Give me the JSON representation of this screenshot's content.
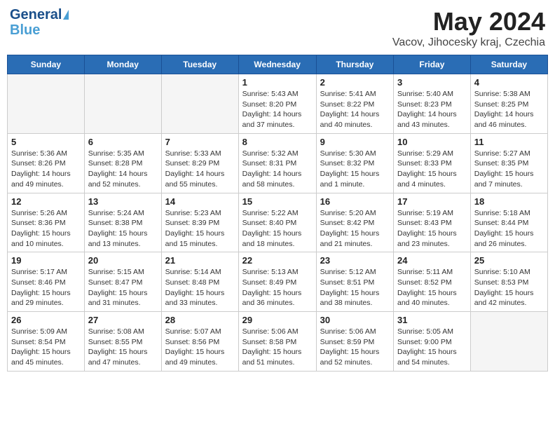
{
  "logo": {
    "line1": "General",
    "line2": "Blue"
  },
  "title": "May 2024",
  "subtitle": "Vacov, Jihocesky kraj, Czechia",
  "days_of_week": [
    "Sunday",
    "Monday",
    "Tuesday",
    "Wednesday",
    "Thursday",
    "Friday",
    "Saturday"
  ],
  "weeks": [
    [
      {
        "day": "",
        "info": ""
      },
      {
        "day": "",
        "info": ""
      },
      {
        "day": "",
        "info": ""
      },
      {
        "day": "1",
        "info": "Sunrise: 5:43 AM\nSunset: 8:20 PM\nDaylight: 14 hours\nand 37 minutes."
      },
      {
        "day": "2",
        "info": "Sunrise: 5:41 AM\nSunset: 8:22 PM\nDaylight: 14 hours\nand 40 minutes."
      },
      {
        "day": "3",
        "info": "Sunrise: 5:40 AM\nSunset: 8:23 PM\nDaylight: 14 hours\nand 43 minutes."
      },
      {
        "day": "4",
        "info": "Sunrise: 5:38 AM\nSunset: 8:25 PM\nDaylight: 14 hours\nand 46 minutes."
      }
    ],
    [
      {
        "day": "5",
        "info": "Sunrise: 5:36 AM\nSunset: 8:26 PM\nDaylight: 14 hours\nand 49 minutes."
      },
      {
        "day": "6",
        "info": "Sunrise: 5:35 AM\nSunset: 8:28 PM\nDaylight: 14 hours\nand 52 minutes."
      },
      {
        "day": "7",
        "info": "Sunrise: 5:33 AM\nSunset: 8:29 PM\nDaylight: 14 hours\nand 55 minutes."
      },
      {
        "day": "8",
        "info": "Sunrise: 5:32 AM\nSunset: 8:31 PM\nDaylight: 14 hours\nand 58 minutes."
      },
      {
        "day": "9",
        "info": "Sunrise: 5:30 AM\nSunset: 8:32 PM\nDaylight: 15 hours\nand 1 minute."
      },
      {
        "day": "10",
        "info": "Sunrise: 5:29 AM\nSunset: 8:33 PM\nDaylight: 15 hours\nand 4 minutes."
      },
      {
        "day": "11",
        "info": "Sunrise: 5:27 AM\nSunset: 8:35 PM\nDaylight: 15 hours\nand 7 minutes."
      }
    ],
    [
      {
        "day": "12",
        "info": "Sunrise: 5:26 AM\nSunset: 8:36 PM\nDaylight: 15 hours\nand 10 minutes."
      },
      {
        "day": "13",
        "info": "Sunrise: 5:24 AM\nSunset: 8:38 PM\nDaylight: 15 hours\nand 13 minutes."
      },
      {
        "day": "14",
        "info": "Sunrise: 5:23 AM\nSunset: 8:39 PM\nDaylight: 15 hours\nand 15 minutes."
      },
      {
        "day": "15",
        "info": "Sunrise: 5:22 AM\nSunset: 8:40 PM\nDaylight: 15 hours\nand 18 minutes."
      },
      {
        "day": "16",
        "info": "Sunrise: 5:20 AM\nSunset: 8:42 PM\nDaylight: 15 hours\nand 21 minutes."
      },
      {
        "day": "17",
        "info": "Sunrise: 5:19 AM\nSunset: 8:43 PM\nDaylight: 15 hours\nand 23 minutes."
      },
      {
        "day": "18",
        "info": "Sunrise: 5:18 AM\nSunset: 8:44 PM\nDaylight: 15 hours\nand 26 minutes."
      }
    ],
    [
      {
        "day": "19",
        "info": "Sunrise: 5:17 AM\nSunset: 8:46 PM\nDaylight: 15 hours\nand 29 minutes."
      },
      {
        "day": "20",
        "info": "Sunrise: 5:15 AM\nSunset: 8:47 PM\nDaylight: 15 hours\nand 31 minutes."
      },
      {
        "day": "21",
        "info": "Sunrise: 5:14 AM\nSunset: 8:48 PM\nDaylight: 15 hours\nand 33 minutes."
      },
      {
        "day": "22",
        "info": "Sunrise: 5:13 AM\nSunset: 8:49 PM\nDaylight: 15 hours\nand 36 minutes."
      },
      {
        "day": "23",
        "info": "Sunrise: 5:12 AM\nSunset: 8:51 PM\nDaylight: 15 hours\nand 38 minutes."
      },
      {
        "day": "24",
        "info": "Sunrise: 5:11 AM\nSunset: 8:52 PM\nDaylight: 15 hours\nand 40 minutes."
      },
      {
        "day": "25",
        "info": "Sunrise: 5:10 AM\nSunset: 8:53 PM\nDaylight: 15 hours\nand 42 minutes."
      }
    ],
    [
      {
        "day": "26",
        "info": "Sunrise: 5:09 AM\nSunset: 8:54 PM\nDaylight: 15 hours\nand 45 minutes."
      },
      {
        "day": "27",
        "info": "Sunrise: 5:08 AM\nSunset: 8:55 PM\nDaylight: 15 hours\nand 47 minutes."
      },
      {
        "day": "28",
        "info": "Sunrise: 5:07 AM\nSunset: 8:56 PM\nDaylight: 15 hours\nand 49 minutes."
      },
      {
        "day": "29",
        "info": "Sunrise: 5:06 AM\nSunset: 8:58 PM\nDaylight: 15 hours\nand 51 minutes."
      },
      {
        "day": "30",
        "info": "Sunrise: 5:06 AM\nSunset: 8:59 PM\nDaylight: 15 hours\nand 52 minutes."
      },
      {
        "day": "31",
        "info": "Sunrise: 5:05 AM\nSunset: 9:00 PM\nDaylight: 15 hours\nand 54 minutes."
      },
      {
        "day": "",
        "info": ""
      }
    ]
  ]
}
